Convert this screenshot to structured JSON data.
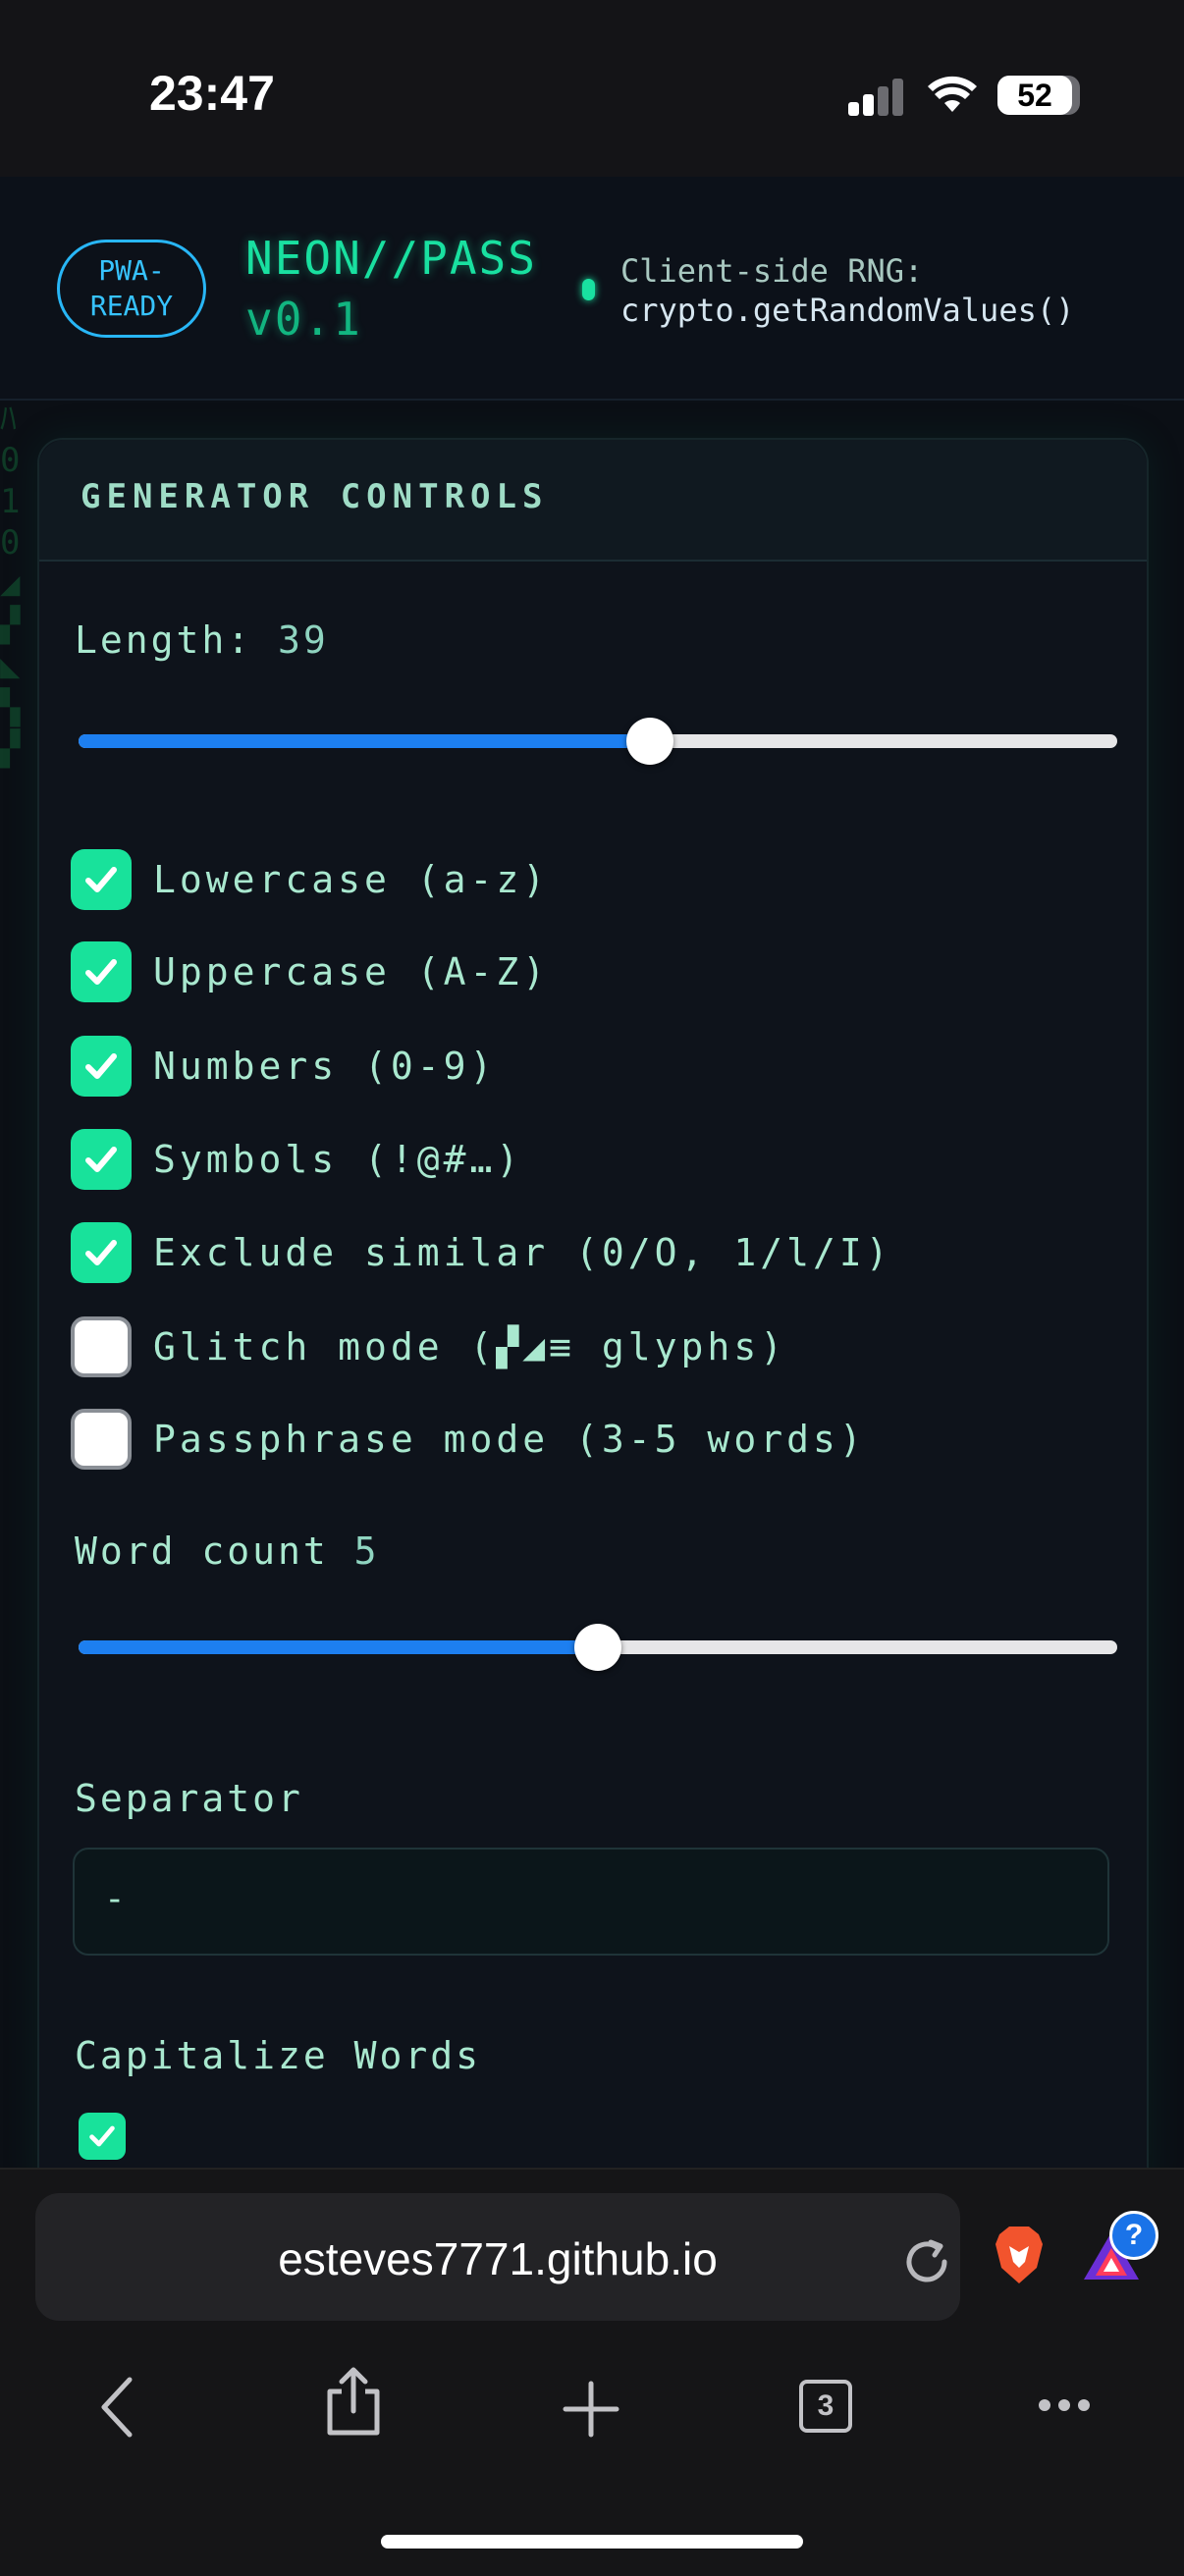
{
  "status": {
    "time": "23:47",
    "battery": "52"
  },
  "header": {
    "badge": "PWA-READY",
    "brand_name": "NEON//PASS",
    "brand_version": "v0.1",
    "rng_label": "Client-side RNG:",
    "rng_api": "crypto.getRandomValues()"
  },
  "panel": {
    "title": "GENERATOR CONTROLS",
    "length_label": "Length:",
    "length_value": "39",
    "length_fraction": 0.55,
    "options": [
      {
        "label": "Lowercase (a-z)",
        "checked": true
      },
      {
        "label": "Uppercase (A-Z)",
        "checked": true
      },
      {
        "label": "Numbers (0-9)",
        "checked": true
      },
      {
        "label": "Symbols (!@#…)",
        "checked": true
      },
      {
        "label": "Exclude similar (0/O, 1/l/I)",
        "checked": true
      },
      {
        "label": "Glitch mode (▞◢≡ glyphs)",
        "checked": false
      },
      {
        "label": "Passphrase mode (3-5 words)",
        "checked": false
      }
    ],
    "word_count_label": "Word count",
    "word_count_value": "5",
    "word_count_fraction": 0.5,
    "separator_label": "Separator",
    "separator_value": "-",
    "capitalize_label": "Capitalize Words",
    "capitalize_checked": true
  },
  "browser": {
    "url": "esteves7771.github.io",
    "tab_count": "3",
    "badge": "?"
  }
}
